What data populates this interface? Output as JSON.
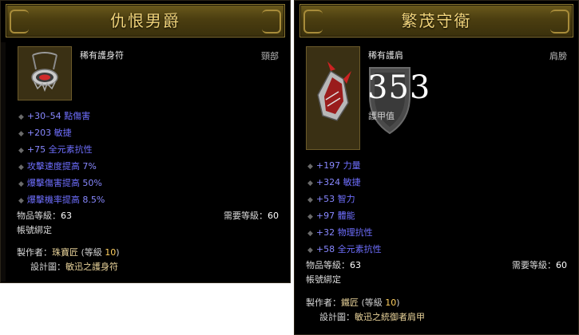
{
  "left": {
    "title": "仇恨男爵",
    "item_type": "稀有護身符",
    "slot": "頸部",
    "stats": [
      {
        "num": "+30–54",
        "text": " 點傷害"
      },
      {
        "num": "+203",
        "text": " 敏捷"
      },
      {
        "num": "+75",
        "text": " 全元素抗性"
      },
      {
        "num": "",
        "text": "攻擊速度提高 ",
        "pct": "7%"
      },
      {
        "num": "",
        "text": "爆擊傷害提高 ",
        "pct": "50%"
      },
      {
        "num": "",
        "text": "爆擊機率提高 ",
        "pct": "8.5%"
      }
    ],
    "item_level_label": "物品等級：",
    "item_level": "63",
    "req_level_label": "需要等級：",
    "req_level": "60",
    "bound": "帳號綁定",
    "crafter_label": "製作者：",
    "crafter": "珠寶匠",
    "crafter_level_prefix": "(等級 ",
    "crafter_level": "10",
    "crafter_level_suffix": ")",
    "plan_label": "設計圖：",
    "plan": "敏迅之護身符",
    "icon": "amulet-icon"
  },
  "right": {
    "title": "繁茂守衛",
    "item_type": "稀有護肩",
    "slot": "肩膀",
    "armor": "353",
    "armor_label": "護甲值",
    "stats": [
      {
        "num": "+197",
        "text": " 力量"
      },
      {
        "num": "+324",
        "text": " 敏捷"
      },
      {
        "num": "+53",
        "text": " 智力"
      },
      {
        "num": "+97",
        "text": " 體能"
      },
      {
        "num": "+32",
        "text": " 物理抗性"
      },
      {
        "num": "+58",
        "text": " 全元素抗性"
      }
    ],
    "item_level_label": "物品等級：",
    "item_level": "63",
    "req_level_label": "需要等級：",
    "req_level": "60",
    "bound": "帳號綁定",
    "crafter_label": "製作者：",
    "crafter": "鐵匠",
    "crafter_level_prefix": "(等級 ",
    "crafter_level": "10",
    "crafter_level_suffix": ")",
    "plan_label": "設計圖：",
    "plan": "敏迅之統御者肩甲",
    "icon": "shoulder-armor-icon"
  },
  "colors": {
    "title_gold": "#f0d37a",
    "magic_blue": "#6f6fff",
    "tooltip_bg": "#000000"
  }
}
